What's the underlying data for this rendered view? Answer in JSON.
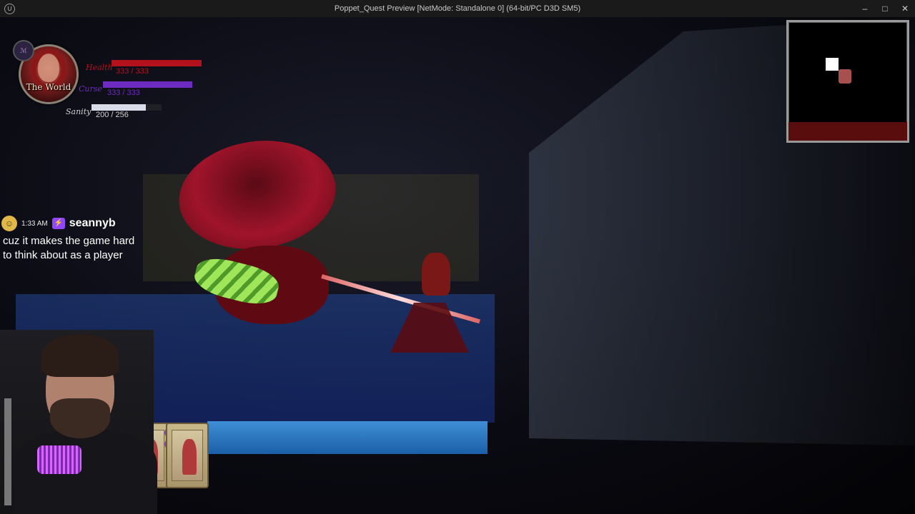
{
  "window": {
    "title": "Poppet_Quest Preview [NetMode: Standalone 0]  (64-bit/PC D3D SM5)",
    "minimize_glyph": "–",
    "maximize_glyph": "□",
    "close_glyph": "✕"
  },
  "hud": {
    "character_name": "The World",
    "level_glyph": "ℳ",
    "stats": [
      {
        "label": "Health",
        "value_text": "333 / 333",
        "fraction": 1.0,
        "color": "#b3121c"
      },
      {
        "label": "Curse",
        "value_text": "333 / 333",
        "fraction": 1.0,
        "color": "#6d2bc2"
      },
      {
        "label": "Sanity",
        "value_text": "200 / 256",
        "fraction": 0.78,
        "color": "#d8dce8"
      }
    ]
  },
  "minimap": {
    "room_color": "#ffffff",
    "player_color": "#a85050",
    "bottom_color": "#5a0d0d"
  },
  "chat": {
    "time": "1:33 AM",
    "username": "seannyb",
    "badge": "⚡",
    "avatar": "☺",
    "message": "cuz it makes the game hard to think about as a player"
  },
  "cards": [
    {
      "name": "card-1"
    },
    {
      "name": "card-2"
    }
  ]
}
